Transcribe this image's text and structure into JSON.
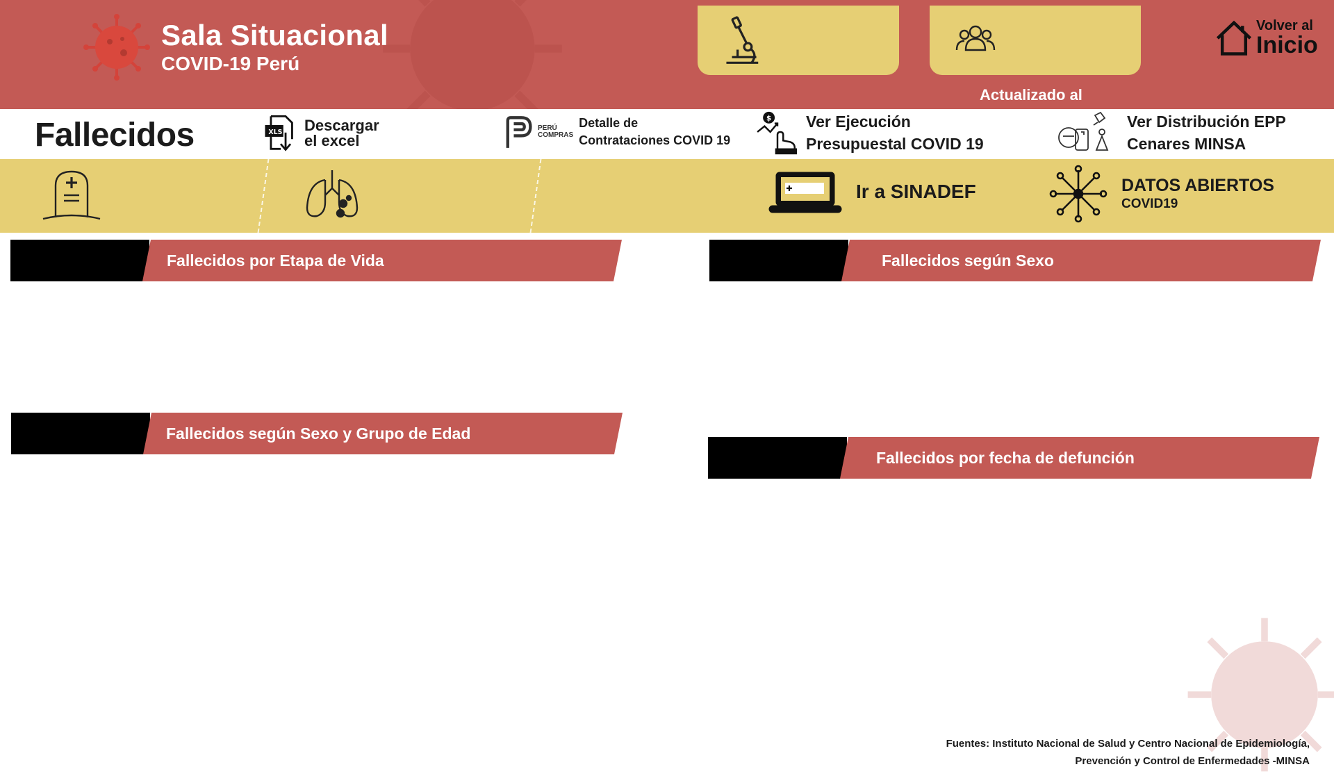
{
  "header": {
    "title": "Sala Situacional",
    "subtitle": "COVID-19 Perú",
    "updated_label": "Actualizado al",
    "home_line1": "Volver al",
    "home_line2": "Inicio",
    "color": "#c35a55",
    "cards": [
      {
        "icon": "microscope-icon"
      },
      {
        "icon": "people-group-icon"
      }
    ]
  },
  "strip": {
    "page_title": "Fallecidos",
    "excel_line1": "Descargar",
    "excel_line2": "el excel",
    "peru_compras_small1": "PERÚ",
    "peru_compras_small2": "COMPRAS",
    "peru_line1": "Detalle  de",
    "peru_line2": "Contrataciones COVID 19",
    "ejec_line1": "Ver Ejecución",
    "ejec_line2": "Presupuestal COVID 19",
    "epp_line1": "Ver Distribución EPP",
    "epp_line2": "Cenares MINSA"
  },
  "band": {
    "color": "#e6cf74",
    "sinadef": "Ir a SINADEF",
    "datos_line1": "DATOS ABIERTOS",
    "datos_line2": "COVID19"
  },
  "sections": {
    "etapa_vida": "Fallecidos por Etapa de Vida",
    "sexo": "Fallecidos según Sexo",
    "sexo_edad": "Fallecidos según Sexo y Grupo de Edad",
    "fecha": "Fallecidos por fecha de defunción"
  },
  "footer": {
    "sources_line1": "Fuentes: Instituto Nacional de Salud y Centro Nacional de Epidemiología,",
    "sources_line2": "Prevención y Control de Enfermedades -MINSA"
  }
}
